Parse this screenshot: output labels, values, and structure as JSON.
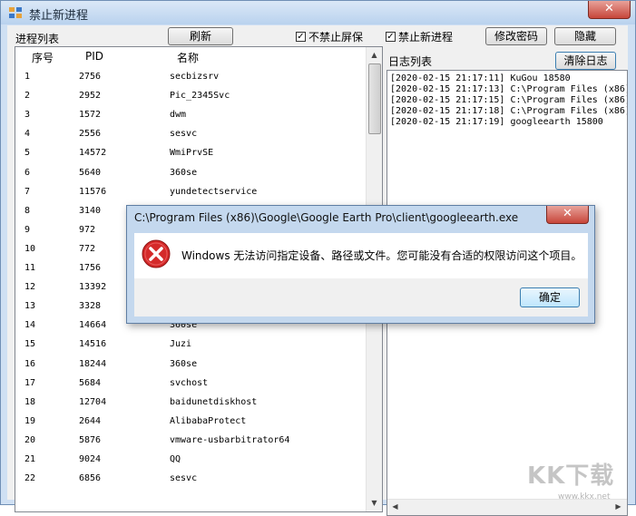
{
  "window": {
    "title": "禁止新进程",
    "close_glyph": "✕"
  },
  "toolbar": {
    "process_list_label": "进程列表",
    "refresh_label": "刷新",
    "no_screensaver": {
      "label": "不禁止屏保",
      "checked": "✓"
    },
    "block_new_process": {
      "label": "禁止新进程",
      "checked": "✓"
    },
    "change_password_label": "修改密码",
    "hide_label": "隐藏"
  },
  "process_table": {
    "columns": [
      "序号",
      "PID",
      "名称"
    ],
    "rows": [
      [
        "1",
        "2756",
        "secbizsrv"
      ],
      [
        "2",
        "2952",
        "Pic_2345Svc"
      ],
      [
        "3",
        "1572",
        "dwm"
      ],
      [
        "4",
        "2556",
        "sesvc"
      ],
      [
        "5",
        "14572",
        "WmiPrvSE"
      ],
      [
        "6",
        "5640",
        "360se"
      ],
      [
        "7",
        "11576",
        "yundetectservice"
      ],
      [
        "8",
        "3140",
        ""
      ],
      [
        "9",
        "972",
        ""
      ],
      [
        "10",
        "772",
        ""
      ],
      [
        "11",
        "1756",
        ""
      ],
      [
        "12",
        "13392",
        ""
      ],
      [
        "13",
        "3328",
        ""
      ],
      [
        "14",
        "14664",
        "360se"
      ],
      [
        "15",
        "14516",
        "Juzi"
      ],
      [
        "16",
        "18244",
        "360se"
      ],
      [
        "17",
        "5684",
        "svchost"
      ],
      [
        "18",
        "12704",
        "baidunetdiskhost"
      ],
      [
        "19",
        "2644",
        "AlibabaProtect"
      ],
      [
        "20",
        "5876",
        "vmware-usbarbitrator64"
      ],
      [
        "21",
        "9024",
        "QQ"
      ],
      [
        "22",
        "6856",
        "sesvc"
      ]
    ]
  },
  "log": {
    "label": "日志列表",
    "clear_label": "清除日志",
    "lines": [
      "[2020-02-15 21:17:11] KuGou 18580",
      "[2020-02-15 21:17:13] C:\\Program Files (x86)",
      "[2020-02-15 21:17:15] C:\\Program Files (x86)",
      "[2020-02-15 21:17:18] C:\\Program Files (x86)",
      "[2020-02-15 21:17:19] googleearth 15800"
    ]
  },
  "dialog": {
    "title": "C:\\Program Files (x86)\\Google\\Google Earth Pro\\client\\googleearth.exe",
    "message": "Windows 无法访问指定设备、路径或文件。您可能没有合适的权限访问这个项目。",
    "ok_label": "确定",
    "icon": "error-icon",
    "close_glyph": "✕"
  },
  "watermark": {
    "text": "KK下载",
    "url": "www.kkx.net"
  },
  "colors": {
    "title_bar": "#c4d8ee",
    "error_red": "#d42a2a",
    "ok_border": "#3c7fb1"
  }
}
